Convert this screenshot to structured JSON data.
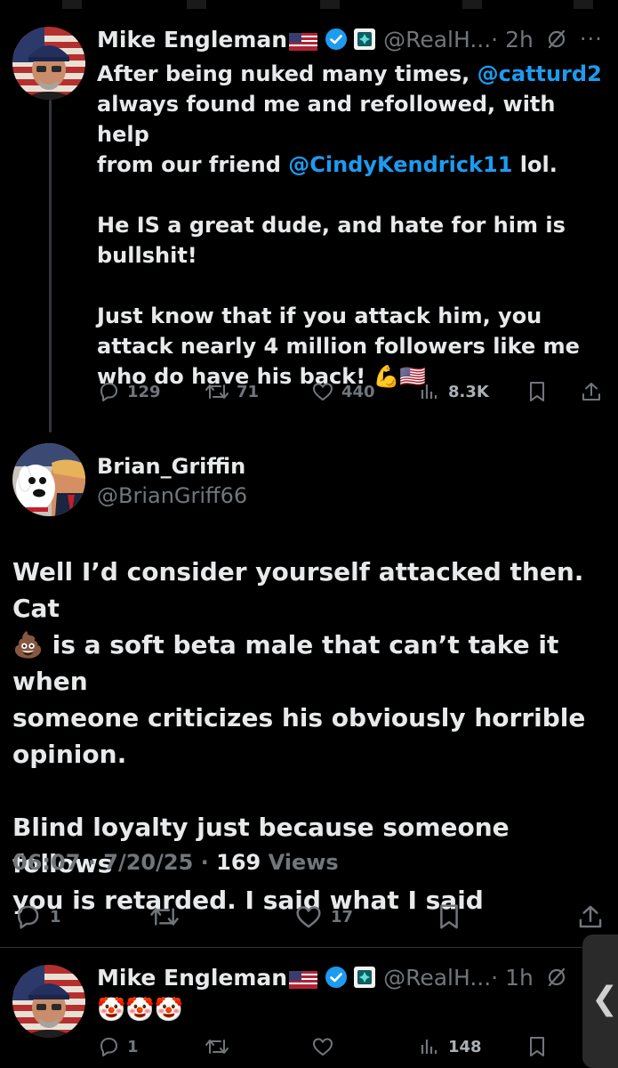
{
  "tweet1": {
    "name": "Mike Engleman",
    "handle": "@RealH...",
    "time": "· 2h",
    "more": "···",
    "text_parts": {
      "a": "After being nuked many times, ",
      "mention1": "@catturd2",
      "b": "\nalways found me and refollowed, with help\nfrom our friend ",
      "mention2": "@CindyKendrick11",
      "c": " lol.\n\nHe IS a great dude, and hate for him is\nbullshit!\n\nJust know that if you attack him, you\nattack nearly 4 million followers like me\nwho do have his back! 💪🇺🇸"
    },
    "actions": {
      "replies": "129",
      "reposts": "71",
      "likes": "440",
      "views": "8.3K"
    }
  },
  "tweet2": {
    "name": "Brian_Griffin",
    "handle": "@BrianGriff66",
    "text": "Well I’d consider yourself attacked then. Cat\n💩 is a soft beta male that can’t take it when\nsomeone criticizes his obviously horrible\nopinion.\n\nBlind loyalty just because someone follows\nyou is retarded. I said what I said",
    "meta": {
      "time": "06:07",
      "date": "7/20/25",
      "views_count": "169",
      "views_label": "Views",
      "sep": "·"
    },
    "actions": {
      "replies": "1",
      "likes": "17"
    }
  },
  "tweet3": {
    "name": "Mike Engleman",
    "handle": "@RealH...",
    "time": "· 1h",
    "text": "🤡🤡🤡",
    "actions": {
      "replies": "1",
      "views": "148"
    }
  },
  "side_tab": {
    "chevron": "❮"
  },
  "colors": {
    "accent": "#1d9bf0",
    "muted": "#71767b",
    "text": "#e7e9ea",
    "background": "#000000"
  }
}
